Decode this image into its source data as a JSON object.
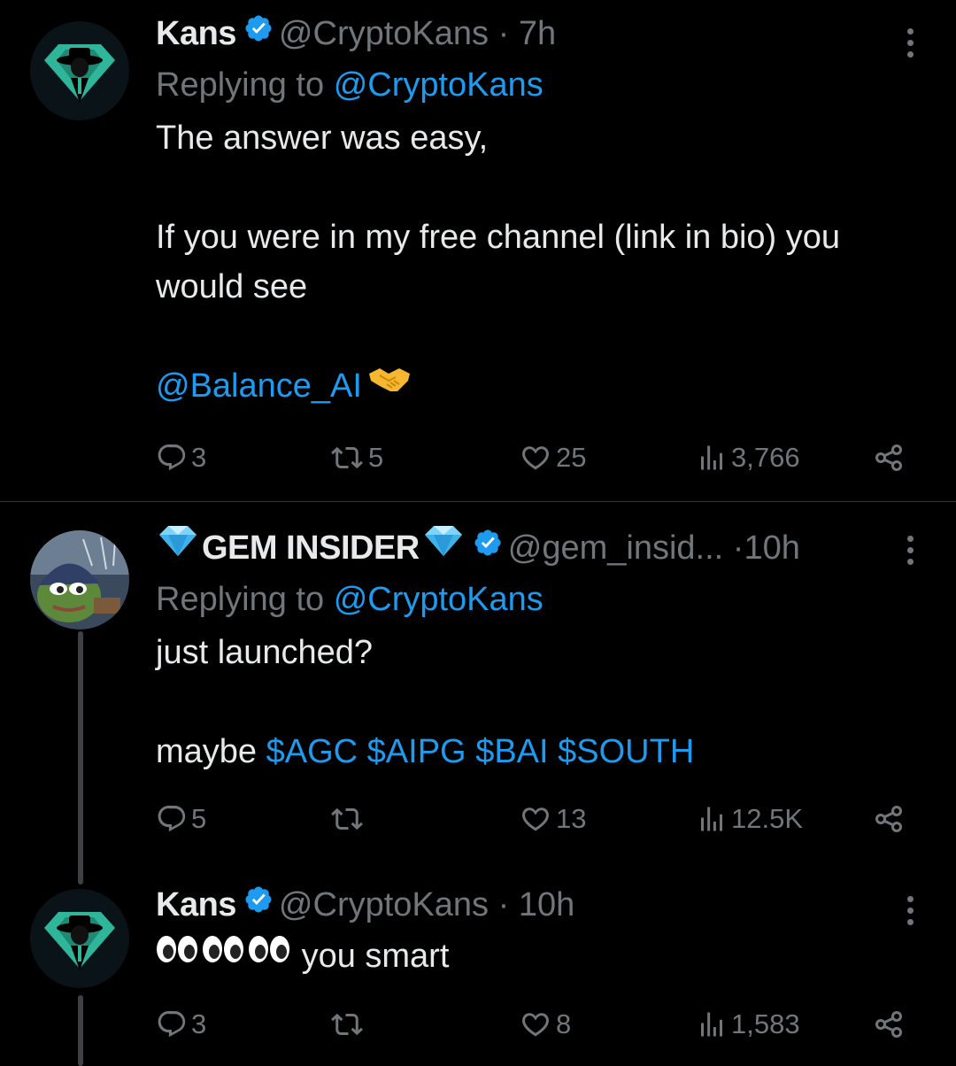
{
  "tweets": [
    {
      "name": "Kans",
      "handle": "@CryptoKans",
      "dot": "·",
      "time": "7h",
      "replying_prefix": "Replying to",
      "replying_handle": "@CryptoKans",
      "body_line1": "The answer was easy,",
      "body_line2": "If you were in my free channel (link in bio) you would see",
      "mention": "@Balance_AI",
      "replies": "3",
      "retweets": "5",
      "likes": "25",
      "views": "3,766",
      "avatar_icon": "anonymous-hacker-emblem"
    },
    {
      "name": "GEM INSIDER",
      "name_decoration": "gem-stone-emoji",
      "handle": "@gem_insid...",
      "dot": "·",
      "time": "10h",
      "replying_prefix": "Replying to",
      "replying_handle": "@CryptoKans",
      "body_line1": "just launched?",
      "body_prefix": "maybe",
      "cashtags": [
        "$AGC",
        "$AIPG",
        "$BAI",
        "$SOUTH"
      ],
      "replies": "5",
      "retweets": "",
      "likes": "13",
      "views": "12.5K",
      "avatar_icon": "pepe-frog-avatar"
    },
    {
      "name": "Kans",
      "handle": "@CryptoKans",
      "dot": "·",
      "time": "10h",
      "body_text": "you smart",
      "body_emoji": "eyes-emoji x3",
      "replies": "3",
      "retweets": "",
      "likes": "8",
      "views": "1,583",
      "avatar_icon": "anonymous-hacker-emblem"
    }
  ],
  "colors": {
    "background": "#000000",
    "text": "#e7e9ea",
    "secondary": "#71767b",
    "link": "#1d9bf0",
    "verified": "#1d9bf0"
  }
}
